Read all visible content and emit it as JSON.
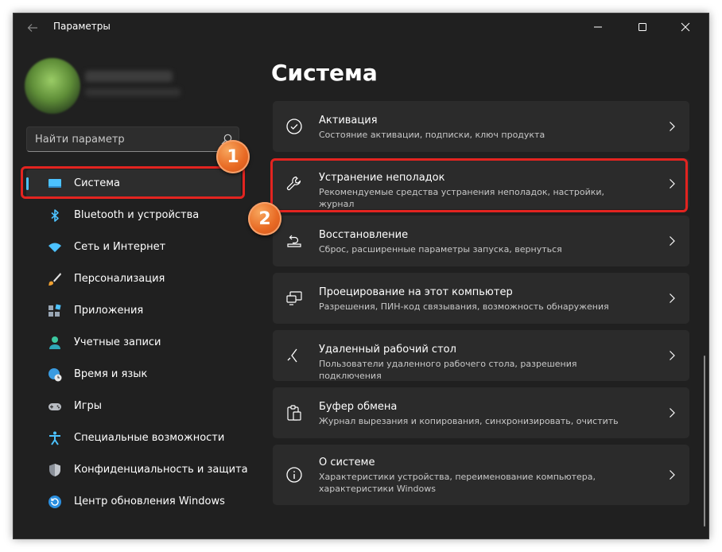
{
  "window": {
    "title": "Параметры",
    "back_icon": "arrow-left-icon",
    "controls": [
      "minimize-icon",
      "maximize-icon",
      "close-icon"
    ]
  },
  "search": {
    "placeholder": "Найти параметр",
    "icon": "search-icon"
  },
  "sidebar": {
    "items": [
      {
        "label": "Система",
        "icon": "monitor-icon",
        "active": true
      },
      {
        "label": "Bluetooth и устройства",
        "icon": "bluetooth-icon"
      },
      {
        "label": "Сеть и Интернет",
        "icon": "wifi-icon"
      },
      {
        "label": "Персонализация",
        "icon": "brush-icon"
      },
      {
        "label": "Приложения",
        "icon": "apps-icon"
      },
      {
        "label": "Учетные записи",
        "icon": "person-icon"
      },
      {
        "label": "Время и язык",
        "icon": "globe-clock-icon"
      },
      {
        "label": "Игры",
        "icon": "gamepad-icon"
      },
      {
        "label": "Специальные возможности",
        "icon": "accessibility-icon"
      },
      {
        "label": "Конфиденциальность и защита",
        "icon": "shield-icon"
      },
      {
        "label": "Центр обновления Windows",
        "icon": "update-icon"
      }
    ]
  },
  "main": {
    "title": "Система",
    "cards": [
      {
        "title": "Активация",
        "subtitle": "Состояние активации, подписки, ключ продукта",
        "icon": "check-circle-icon"
      },
      {
        "title": "Устранение неполадок",
        "subtitle": "Рекомендуемые средства устранения неполадок, настройки, журнал",
        "icon": "wrench-icon"
      },
      {
        "title": "Восстановление",
        "subtitle": "Сброс, расширенные параметры запуска, вернуться",
        "icon": "recovery-icon"
      },
      {
        "title": "Проецирование на этот компьютер",
        "subtitle": "Разрешения, ПИН-код связывания, возможность обнаружения",
        "icon": "projection-icon"
      },
      {
        "title": "Удаленный рабочий стол",
        "subtitle": "Пользователи удаленного рабочего стола, разрешения подключения",
        "icon": "remote-desktop-icon"
      },
      {
        "title": "Буфер обмена",
        "subtitle": "Журнал вырезания и копирования, синхронизировать, очистить",
        "icon": "clipboard-icon"
      },
      {
        "title": "О системе",
        "subtitle": "Характеристики устройства, переименование компьютера, характеристики Windows",
        "icon": "info-icon"
      }
    ]
  },
  "annotations": {
    "badge1": "1",
    "badge2": "2",
    "highlight_color": "#e32420",
    "badge_color": "#e86a24"
  },
  "colors": {
    "accent": "#4cc2ff",
    "background": "#202020",
    "card": "#2b2b2b"
  }
}
